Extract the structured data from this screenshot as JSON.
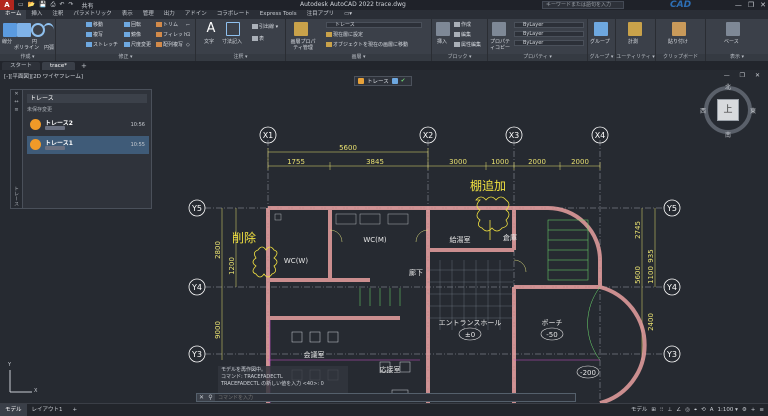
{
  "titlebar": {
    "logo": "A",
    "qat": [
      "▭",
      "📂",
      "💾",
      "⎙",
      "↶",
      "↷"
    ],
    "share": "共有",
    "title": "Autodesk AutoCAD 2022   trace.dwg",
    "search_placeholder": "キーワードまたは語句を入力",
    "brand": "CAD",
    "controls": [
      "—",
      "❐",
      "✕"
    ]
  },
  "ribbon_tabs": [
    "ホーム",
    "挿入",
    "注釈",
    "パラメトリック",
    "表示",
    "管理",
    "出力",
    "アドイン",
    "コラボレート",
    "Express Tools",
    "注目アプリ",
    "▭▾"
  ],
  "ribbon": {
    "draw": {
      "label": "作成 ▾",
      "buttons": [
        "線分",
        "ポリライン",
        "円",
        "円弧"
      ]
    },
    "modify": {
      "label": "修正 ▾",
      "rows": [
        [
          "移動",
          "回転",
          "トリム",
          "⌐"
        ],
        [
          "複写",
          "鏡像",
          "フィレット",
          "⊡"
        ],
        [
          "ストレッチ",
          "尺度変更",
          "配列複写",
          "◇"
        ]
      ]
    },
    "annotation": {
      "label": "注釈 ▾",
      "buttons": [
        "文字",
        "寸法記入"
      ],
      "rows": [
        "引出線 ▾",
        "表"
      ]
    },
    "layers": {
      "label": "画層 ▾",
      "big": "画層プロパティ管理",
      "layer_name": "トレース",
      "rows": [
        "現在層に設定",
        "オブジェクトを現在の画層に移動"
      ]
    },
    "block": {
      "label": "ブロック ▾",
      "big": "挿入",
      "rows": [
        "作成",
        "編集",
        "属性編集"
      ]
    },
    "properties": {
      "label": "プロパティ ▾",
      "big": "プロパティコピー",
      "dropdowns": [
        "ByLayer",
        "ByLayer",
        "ByLayer"
      ]
    },
    "groups": {
      "label": "グループ ▾",
      "big": "グループ"
    },
    "utilities": {
      "label": "ユーティリティ ▾",
      "big": "計測"
    },
    "clipboard": {
      "label": "クリップボード",
      "big": "貼り付け"
    },
    "view": {
      "label": "表示 ▾",
      "big": "ベース"
    }
  },
  "file_tabs": [
    {
      "label": "スタート",
      "active": false
    },
    {
      "label": "trace*",
      "active": true
    }
  ],
  "file_tabs_add": "+",
  "viewport": {
    "label": "[-][平面図][2D ワイヤフレーム]",
    "controls": "— ❐ ✕",
    "trace_bar": {
      "label": "トレース",
      "confirm": "✔"
    },
    "annotations": [
      "削除",
      "棚追加"
    ],
    "rooms": [
      "WC(W)",
      "WC(M)",
      "給湯室",
      "廊下",
      "エントランスホール",
      "会議室",
      "応接室",
      "ポーチ",
      "倉庫"
    ],
    "levels": [
      "±0",
      "-50",
      "-200"
    ],
    "col_grid": [
      "X1",
      "X2",
      "X3",
      "X4"
    ],
    "row_grid": [
      "Y5",
      "Y4",
      "Y3"
    ],
    "top_dims": [
      "5600",
      "1755",
      "3845",
      "3000",
      "1000",
      "2000",
      "2000"
    ],
    "left_dims": [
      "2800",
      "1200",
      "9000"
    ],
    "right_dims": [
      "2745",
      "935",
      "5600",
      "1100",
      "2400"
    ]
  },
  "palette": {
    "strip_icons": [
      "✕",
      "↔",
      "≡"
    ],
    "vertical_label": "トレース",
    "title": "トレース",
    "subtitle": "未保存変更",
    "items": [
      {
        "name": "トレース2",
        "time": "10:56",
        "selected": false
      },
      {
        "name": "トレース1",
        "time": "10:55",
        "selected": true
      }
    ]
  },
  "navcube": {
    "face": "上",
    "north": "北",
    "south": "南",
    "east": "東",
    "west": "西"
  },
  "ucs": {
    "x": "X",
    "y": "Y"
  },
  "command_history": [
    "モデルを再作図中。",
    "コマンド: TRACEFADECTL",
    "TRACEFADECTL の新しい値を入力 <40>: 0"
  ],
  "command_line": {
    "placeholder": "コマンドを入力"
  },
  "status": {
    "tabs": [
      "モデル",
      "レイアウト1",
      "+"
    ],
    "right": [
      "モデル",
      "⊞",
      "⁝⁝",
      "⊥",
      "∠",
      "◎",
      "⌖",
      "⟲",
      "A",
      "1:100 ▾",
      "⚙",
      "+",
      "≡"
    ]
  },
  "colors": {
    "wall": "#e8a0a0",
    "dim": "#e8e070",
    "grid": "#ffffff",
    "stair": "#70e070",
    "door": "#e0e080",
    "aux": "#d050d0",
    "annotation": "#f0e040"
  }
}
